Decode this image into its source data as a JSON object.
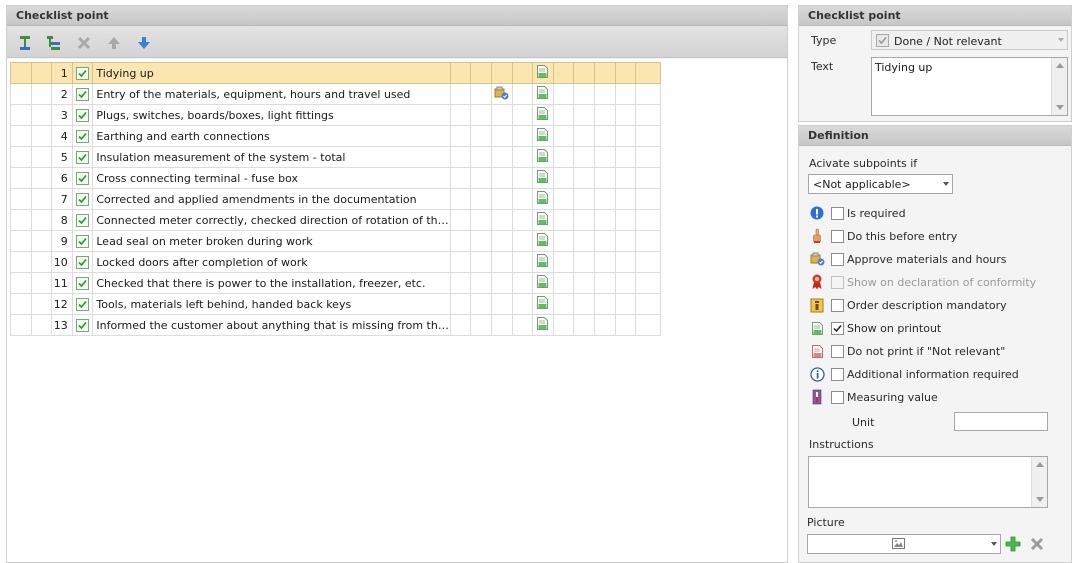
{
  "left_panel": {
    "title": "Checklist point",
    "toolbar": {
      "add": "add-point-icon",
      "add_sub": "add-subpoint-icon",
      "delete": "delete-icon",
      "up": "move-up-icon",
      "down": "move-down-icon"
    },
    "rows": [
      {
        "num": "1",
        "text": "Tidying up",
        "selected": true,
        "approve_icon": false
      },
      {
        "num": "2",
        "text": "Entry of the materials, equipment, hours and travel used",
        "selected": false,
        "approve_icon": true
      },
      {
        "num": "3",
        "text": "Plugs, switches, boards/boxes, light fittings",
        "selected": false,
        "approve_icon": false
      },
      {
        "num": "4",
        "text": "Earthing and earth connections",
        "selected": false,
        "approve_icon": false
      },
      {
        "num": "5",
        "text": "Insulation measurement of the system - total",
        "selected": false,
        "approve_icon": false
      },
      {
        "num": "6",
        "text": "Cross connecting terminal - fuse box",
        "selected": false,
        "approve_icon": false
      },
      {
        "num": "7",
        "text": "Corrected and applied amendments in the documentation",
        "selected": false,
        "approve_icon": false
      },
      {
        "num": "8",
        "text": "Connected meter correctly, checked direction of rotation of the disc",
        "selected": false,
        "approve_icon": false
      },
      {
        "num": "9",
        "text": "Lead seal on meter broken during work",
        "selected": false,
        "approve_icon": false
      },
      {
        "num": "10",
        "text": "Locked doors after completion of work",
        "selected": false,
        "approve_icon": false
      },
      {
        "num": "11",
        "text": "Checked that there is power to the installation, freezer, etc.",
        "selected": false,
        "approve_icon": false
      },
      {
        "num": "12",
        "text": "Tools, materials left behind, handed back keys",
        "selected": false,
        "approve_icon": false
      },
      {
        "num": "13",
        "text": "Informed the customer about anything that is missing from the install...",
        "selected": false,
        "approve_icon": false
      }
    ]
  },
  "checklist_panel": {
    "title": "Checklist point",
    "type_label": "Type",
    "type_value": "Done / Not relevant",
    "text_label": "Text",
    "text_value": "Tidying up"
  },
  "definition_panel": {
    "title": "Definition",
    "activate_label": "Acivate subpoints if",
    "activate_value": "<Not applicable>",
    "options": [
      {
        "label": "Is required",
        "icon": "exclamation-icon",
        "checked": false,
        "disabled": false
      },
      {
        "label": "Do this before entry",
        "icon": "finger-pointer-icon",
        "checked": false,
        "disabled": false
      },
      {
        "label": "Approve materials and hours",
        "icon": "approve-materials-icon",
        "checked": false,
        "disabled": false
      },
      {
        "label": "Show on declaration of conformity",
        "icon": "ribbon-award-icon",
        "checked": false,
        "disabled": true
      },
      {
        "label": "Order description mandatory",
        "icon": "order-description-icon",
        "checked": false,
        "disabled": false
      },
      {
        "label": "Show on printout",
        "icon": "green-document-icon",
        "checked": true,
        "disabled": false
      },
      {
        "label": "Do not print if \"Not relevant\"",
        "icon": "red-document-icon",
        "checked": false,
        "disabled": false
      },
      {
        "label": "Additional information required",
        "icon": "info-icon",
        "checked": false,
        "disabled": false
      },
      {
        "label": "Measuring value",
        "icon": "thermometer-icon",
        "checked": false,
        "disabled": false
      }
    ],
    "unit_label": "Unit",
    "unit_value": "",
    "instructions_label": "Instructions",
    "instructions_value": "",
    "picture_label": "Picture",
    "picture_value": ""
  },
  "colors": {
    "selected_row": "#fbe6b1",
    "header": "#c7c7c7",
    "check_green": "#2e9a2e"
  }
}
